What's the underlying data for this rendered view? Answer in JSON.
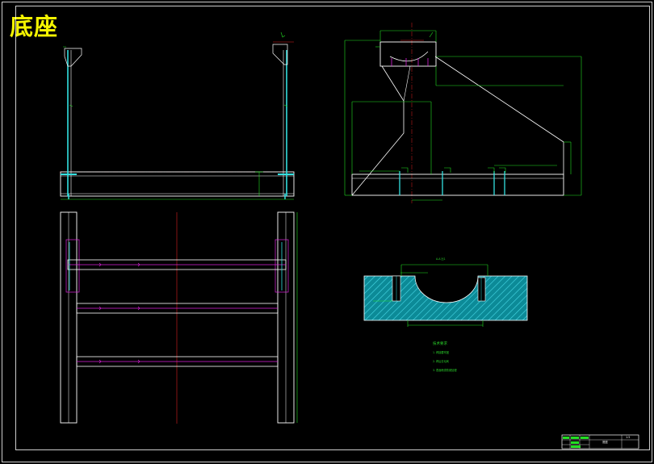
{
  "title": "底座",
  "section_label": "A-A  比1",
  "tech_notes": {
    "heading": "技术要求",
    "items": [
      "1. 焊接要牢固",
      "2. 焊后去毛刺",
      "3. 表面喷漆防锈处理"
    ]
  },
  "title_block": {
    "name": "底座",
    "scale": "1:5",
    "cells": [
      "设计",
      "审核",
      "工艺",
      "日期"
    ]
  },
  "colors": {
    "background": "#000000",
    "frame": "#ffffff",
    "outline": "#ffffff",
    "dimension": "#22dd22",
    "centerline": "#dd2222",
    "hidden": "#dd22dd",
    "column": "#33e0e0",
    "hatch": "#19bfcf",
    "title": "#f4f400"
  }
}
